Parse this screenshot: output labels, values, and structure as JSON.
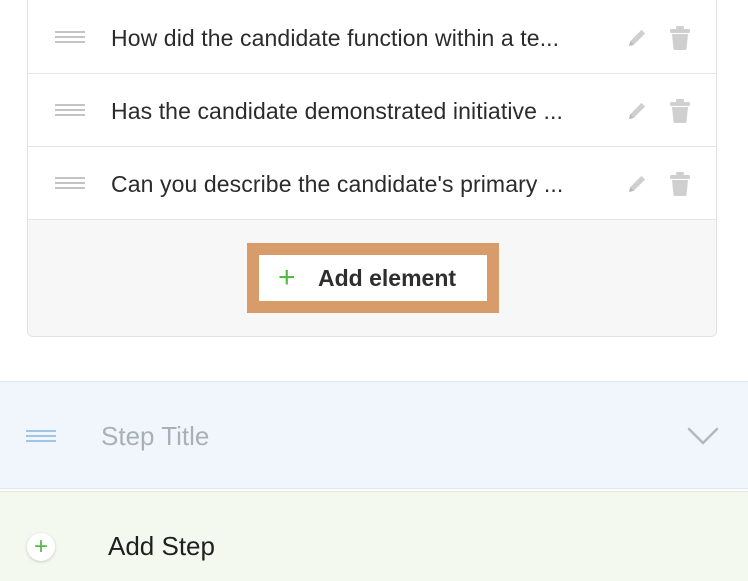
{
  "questions": [
    {
      "text": "How did the candidate function within a te..."
    },
    {
      "text": "Has the candidate demonstrated initiative ..."
    },
    {
      "text": "Can you describe the candidate's primary ..."
    }
  ],
  "add_element": {
    "icon": "+",
    "label": "Add element"
  },
  "step": {
    "title_placeholder": "Step Title"
  },
  "add_step": {
    "icon": "+",
    "label": "Add Step"
  },
  "colors": {
    "accent_green": "#57b847",
    "highlight_orange": "#d89b6a",
    "step_bar_bg": "#f1f6fc",
    "add_step_bg": "#f4f9ef",
    "icon_gray": "#c9c9c9"
  }
}
